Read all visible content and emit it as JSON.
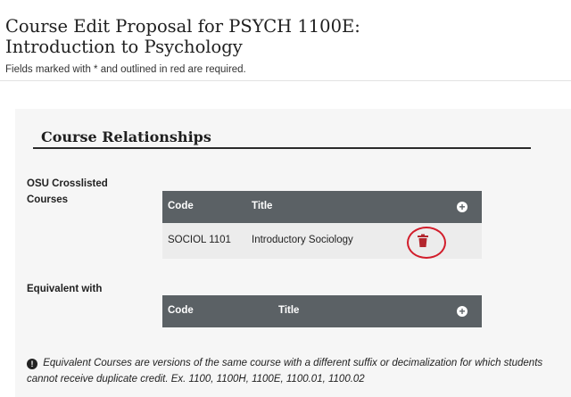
{
  "page": {
    "title": "Course Edit Proposal for PSYCH 1100E: Introduction to Psychology",
    "required_note": "Fields marked with * and outlined in red are required."
  },
  "section": {
    "heading": "Course Relationships"
  },
  "crosslisted": {
    "label": "OSU Crosslisted Courses",
    "columns": {
      "code": "Code",
      "title": "Title"
    },
    "add_icon": "plus-circle-icon",
    "rows": [
      {
        "code": "SOCIOL 1101",
        "title": "Introductory Sociology",
        "delete_icon": "trash-icon"
      }
    ],
    "highlight_color": "#d21d2b"
  },
  "equivalent": {
    "label": "Equivalent with",
    "columns": {
      "code": "Code",
      "title": "Title"
    },
    "add_icon": "plus-circle-icon"
  },
  "info": {
    "icon": "exclamation-circle-icon",
    "text": "Equivalent Courses are versions of the same course with a different suffix or decimalization for which students cannot receive duplicate credit. Ex. 1100, 1100H, 1100E, 1100.01, 1100.02"
  },
  "colors": {
    "table_header": "#5b6165",
    "delete": "#b3262e",
    "panel": "#f6f6f6"
  }
}
